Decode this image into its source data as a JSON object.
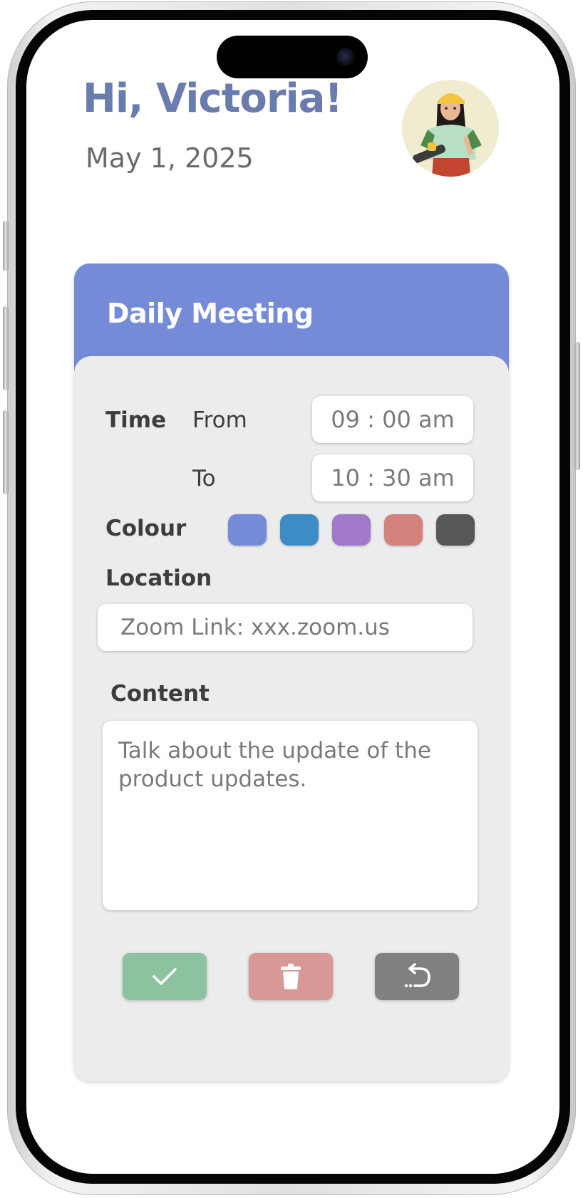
{
  "header": {
    "greeting": "Hi, Victoria!",
    "date": "May 1, 2025",
    "avatar_icon": "avatar-icon"
  },
  "card": {
    "title": "Daily Meeting",
    "header_color": "#768bd8",
    "time": {
      "label": "Time",
      "from_label": "From",
      "from_value": "09 : 00 am",
      "to_label": "To",
      "to_value": "10  : 30 am"
    },
    "colour": {
      "label": "Colour",
      "options": [
        "#768bd8",
        "#3d8cc6",
        "#a079c9",
        "#d2817c",
        "#575757"
      ]
    },
    "location": {
      "label": "Location",
      "value": "Zoom Link: xxx.zoom.us"
    },
    "content": {
      "label": "Content",
      "value": "Talk about the update of the product updates."
    },
    "actions": {
      "confirm_icon": "check-icon",
      "confirm_color": "#8cc2a0",
      "delete_icon": "trash-icon",
      "delete_color": "#d89898",
      "undo_icon": "undo-icon",
      "undo_color": "#808080"
    }
  }
}
